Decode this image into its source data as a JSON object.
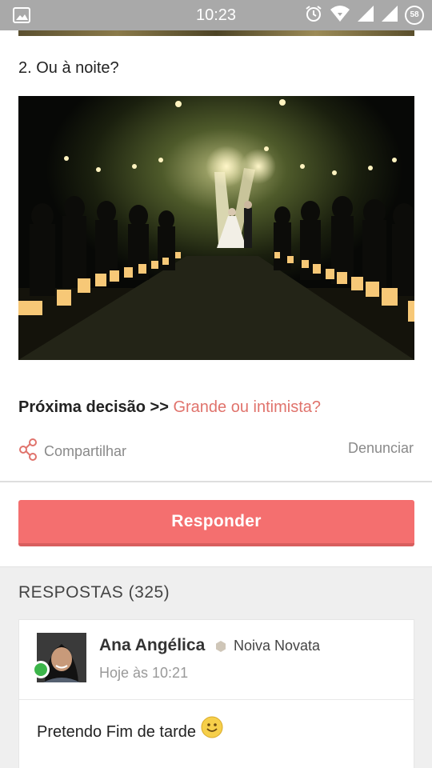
{
  "status_bar": {
    "time": "10:23",
    "battery_level": "58",
    "icons": [
      "image-icon",
      "alarm-icon",
      "wifi-icon",
      "signal-icon",
      "signal-icon",
      "battery-icon"
    ]
  },
  "post": {
    "question": "2. Ou à noite?",
    "next_decision_prefix": "Próxima decisão >>",
    "next_decision_link": "Grande ou intimista?",
    "share_label": "Compartilhar",
    "report_label": "Denunciar"
  },
  "reply_button": {
    "label": "Responder"
  },
  "answers": {
    "title": "RESPOSTAS (325)",
    "items": [
      {
        "author": "Ana Angélica",
        "rank": "Noiva Novata",
        "time": "Hoje às 10:21",
        "text": "Pretendo Fim de tarde",
        "online": true
      }
    ]
  },
  "colors": {
    "accent": "#f46f6f",
    "link": "#e0736c",
    "status_bar": "#a9a9a9",
    "online": "#3cb54a"
  }
}
